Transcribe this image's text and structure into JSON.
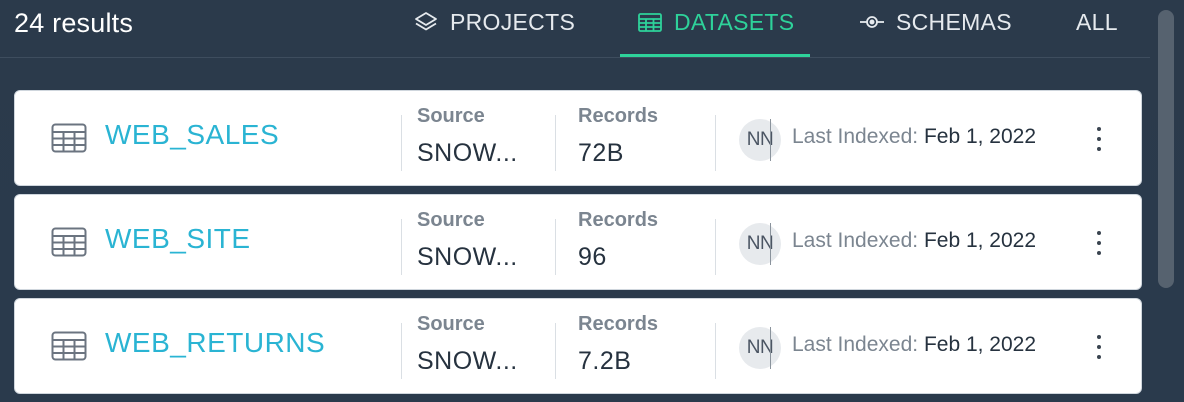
{
  "results_count": "24 results",
  "tabs": [
    {
      "label": "PROJECTS",
      "icon": "layers-icon",
      "active": false
    },
    {
      "label": "DATASETS",
      "icon": "table-icon",
      "active": true
    },
    {
      "label": "SCHEMAS",
      "icon": "schema-icon",
      "active": false
    },
    {
      "label": "ALL",
      "active": false
    }
  ],
  "colors": {
    "background": "#2b3a4b",
    "active_tab": "#2ed29a",
    "dataset_link": "#2ab4d3",
    "card": "#ffffff"
  },
  "datasets": [
    {
      "name": "WEB_SALES",
      "source_label": "Source",
      "source_value": "SNOW...",
      "records_label": "Records",
      "records_value": "72B",
      "avatar_initials": "NN",
      "last_indexed_label": "Last Indexed:",
      "last_indexed_date": "Feb 1, 2022"
    },
    {
      "name": "WEB_SITE",
      "source_label": "Source",
      "source_value": "SNOW...",
      "records_label": "Records",
      "records_value": "96",
      "avatar_initials": "NN",
      "last_indexed_label": "Last Indexed:",
      "last_indexed_date": "Feb 1, 2022"
    },
    {
      "name": "WEB_RETURNS",
      "source_label": "Source",
      "source_value": "SNOW...",
      "records_label": "Records",
      "records_value": "7.2B",
      "avatar_initials": "NN",
      "last_indexed_label": "Last Indexed:",
      "last_indexed_date": "Feb 1, 2022"
    }
  ]
}
